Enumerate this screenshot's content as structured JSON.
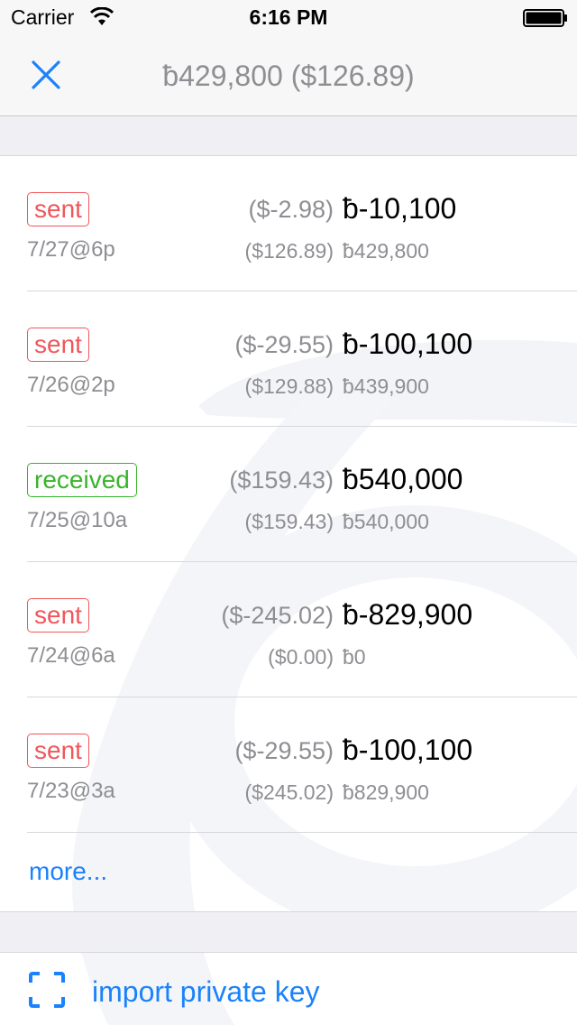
{
  "status_bar": {
    "carrier": "Carrier",
    "time": "6:16 PM"
  },
  "nav": {
    "title": "ƀ429,800 ($126.89)"
  },
  "transactions": [
    {
      "type": "sent",
      "date": "7/27@6p",
      "fiat": "($-2.98)",
      "amount": "ƀ-10,100",
      "balance_fiat": "($126.89)",
      "balance": "ƀ429,800"
    },
    {
      "type": "sent",
      "date": "7/26@2p",
      "fiat": "($-29.55)",
      "amount": "ƀ-100,100",
      "balance_fiat": "($129.88)",
      "balance": "ƀ439,900"
    },
    {
      "type": "received",
      "date": "7/25@10a",
      "fiat": "($159.43)",
      "amount": "ƀ540,000",
      "balance_fiat": "($159.43)",
      "balance": "ƀ540,000"
    },
    {
      "type": "sent",
      "date": "7/24@6a",
      "fiat": "($-245.02)",
      "amount": "ƀ-829,900",
      "balance_fiat": "($0.00)",
      "balance": "ƀ0"
    },
    {
      "type": "sent",
      "date": "7/23@3a",
      "fiat": "($-29.55)",
      "amount": "ƀ-100,100",
      "balance_fiat": "($245.02)",
      "balance": "ƀ829,900"
    }
  ],
  "more_label": "more...",
  "import_label": "import private key",
  "colors": {
    "accent": "#1a82fb",
    "sent": "#f0565a",
    "received": "#38b52a",
    "secondary_text": "#8e8e93"
  },
  "icons": {
    "close": "close-icon",
    "scan": "scan-icon",
    "wifi": "wifi-icon",
    "battery": "battery-icon"
  }
}
